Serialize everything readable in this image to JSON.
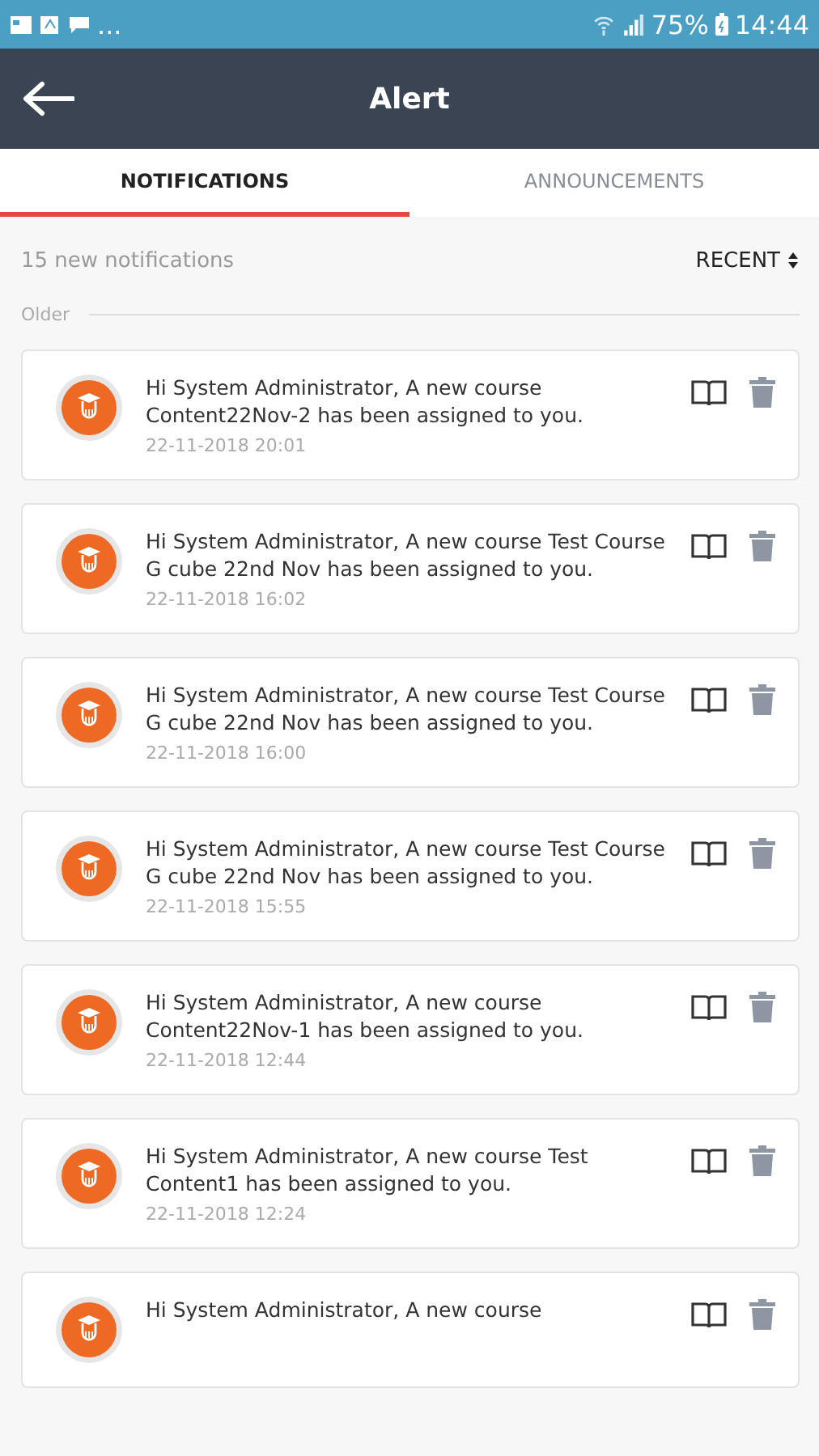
{
  "status_bar": {
    "more": "...",
    "battery": "75%",
    "time": "14:44"
  },
  "header": {
    "title": "Alert"
  },
  "tabs": [
    {
      "label": "NOTIFICATIONS",
      "selected": true
    },
    {
      "label": "ANNOUNCEMENTS",
      "selected": false
    }
  ],
  "summary": "15 new notifications",
  "sort": {
    "label": "RECENT"
  },
  "section": "Older",
  "notifications": [
    {
      "message": "Hi System Administrator, A new course Content22Nov-2 has been assigned to you.",
      "time": "22-11-2018 20:01"
    },
    {
      "message": "Hi System Administrator, A new course Test Course G cube 22nd Nov has been assigned to you.",
      "time": "22-11-2018 16:02"
    },
    {
      "message": "Hi System Administrator, A new course Test Course G cube 22nd Nov has been assigned to you.",
      "time": "22-11-2018 16:00"
    },
    {
      "message": "Hi System Administrator, A new course Test Course G cube 22nd Nov has been assigned to you.",
      "time": "22-11-2018 15:55"
    },
    {
      "message": "Hi System Administrator, A new course Content22Nov-1 has been assigned to you.",
      "time": "22-11-2018 12:44"
    },
    {
      "message": "Hi System Administrator, A new course Test Content1 has been assigned to you.",
      "time": "22-11-2018 12:24"
    },
    {
      "message": "Hi System Administrator, A new course"
    }
  ]
}
